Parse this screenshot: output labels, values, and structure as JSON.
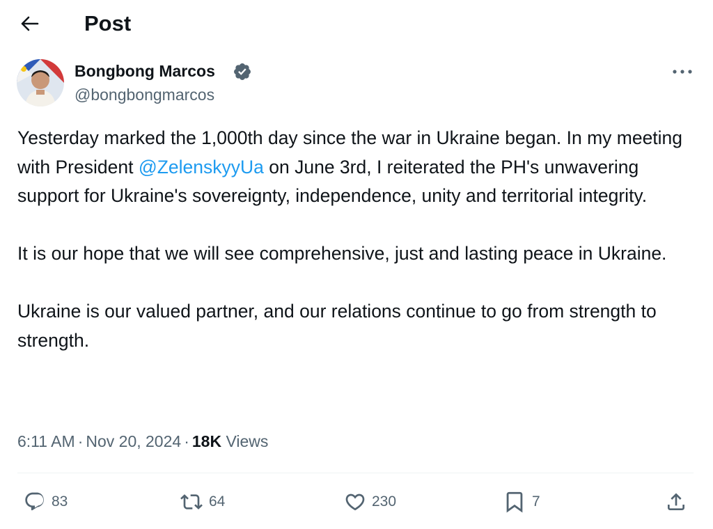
{
  "header": {
    "back_icon": "arrow-left-icon",
    "title": "Post"
  },
  "author": {
    "name": "Bongbong Marcos",
    "handle": "@bongbongmarcos",
    "verified": true,
    "verified_color": "#536471"
  },
  "post": {
    "paragraphs": [
      {
        "before_mention": "Yesterday marked the 1,000th day since the war in Ukraine began. In my meeting with President ",
        "mention": "@ZelenskyyUa",
        "after_mention": " on June 3rd, I reiterated the PH's unwavering support for Ukraine's sovereignty, independence, unity and territorial integrity."
      },
      {
        "text": "It is our hope that we will see comprehensive, just and lasting peace in Ukraine."
      },
      {
        "text": "Ukraine is our valued partner, and our relations continue to go from strength to strength."
      }
    ],
    "time": "6:11 AM",
    "date": "Nov 20, 2024",
    "views_count": "18K",
    "views_label": "Views"
  },
  "actions": {
    "replies": "83",
    "reposts": "64",
    "likes": "230",
    "bookmarks": "7"
  },
  "colors": {
    "text": "#0f1419",
    "secondary": "#536471",
    "link": "#1d9bf0",
    "divider": "#eff3f4"
  }
}
